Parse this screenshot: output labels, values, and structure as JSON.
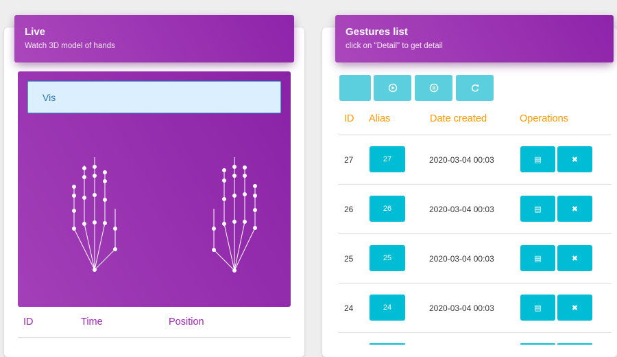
{
  "live": {
    "title": "Live",
    "subtitle": "Watch 3D model of hands",
    "vis_label": "Vis",
    "table_headers": [
      "ID",
      "Time",
      "Position"
    ]
  },
  "gestures": {
    "title": "Gestures list",
    "subtitle": "click on \"Detail\" to get detail",
    "toolbar": [
      {
        "icon": "blank",
        "label": ""
      },
      {
        "icon": "play-circle-icon",
        "label": ""
      },
      {
        "icon": "pause-circle-icon",
        "label": ""
      },
      {
        "icon": "refresh-icon",
        "label": ""
      }
    ],
    "table_headers": [
      "ID",
      "Alias",
      "Date created",
      "Operations"
    ],
    "rows": [
      {
        "id": "27",
        "alias": "27",
        "date": "2020-03-04 00:03"
      },
      {
        "id": "26",
        "alias": "26",
        "date": "2020-03-04 00:03"
      },
      {
        "id": "25",
        "alias": "25",
        "date": "2020-03-04 00:03"
      },
      {
        "id": "24",
        "alias": "24",
        "date": "2020-03-04 00:03"
      }
    ],
    "detail_icon": "▤",
    "delete_icon": "✖"
  },
  "colors": {
    "header_gradient_start": "#ab47bc",
    "header_gradient_end": "#8e24aa",
    "accent_cyan": "#00bcd4",
    "left_header_text": "#9c27b0",
    "right_header_text": "#ff9800"
  }
}
